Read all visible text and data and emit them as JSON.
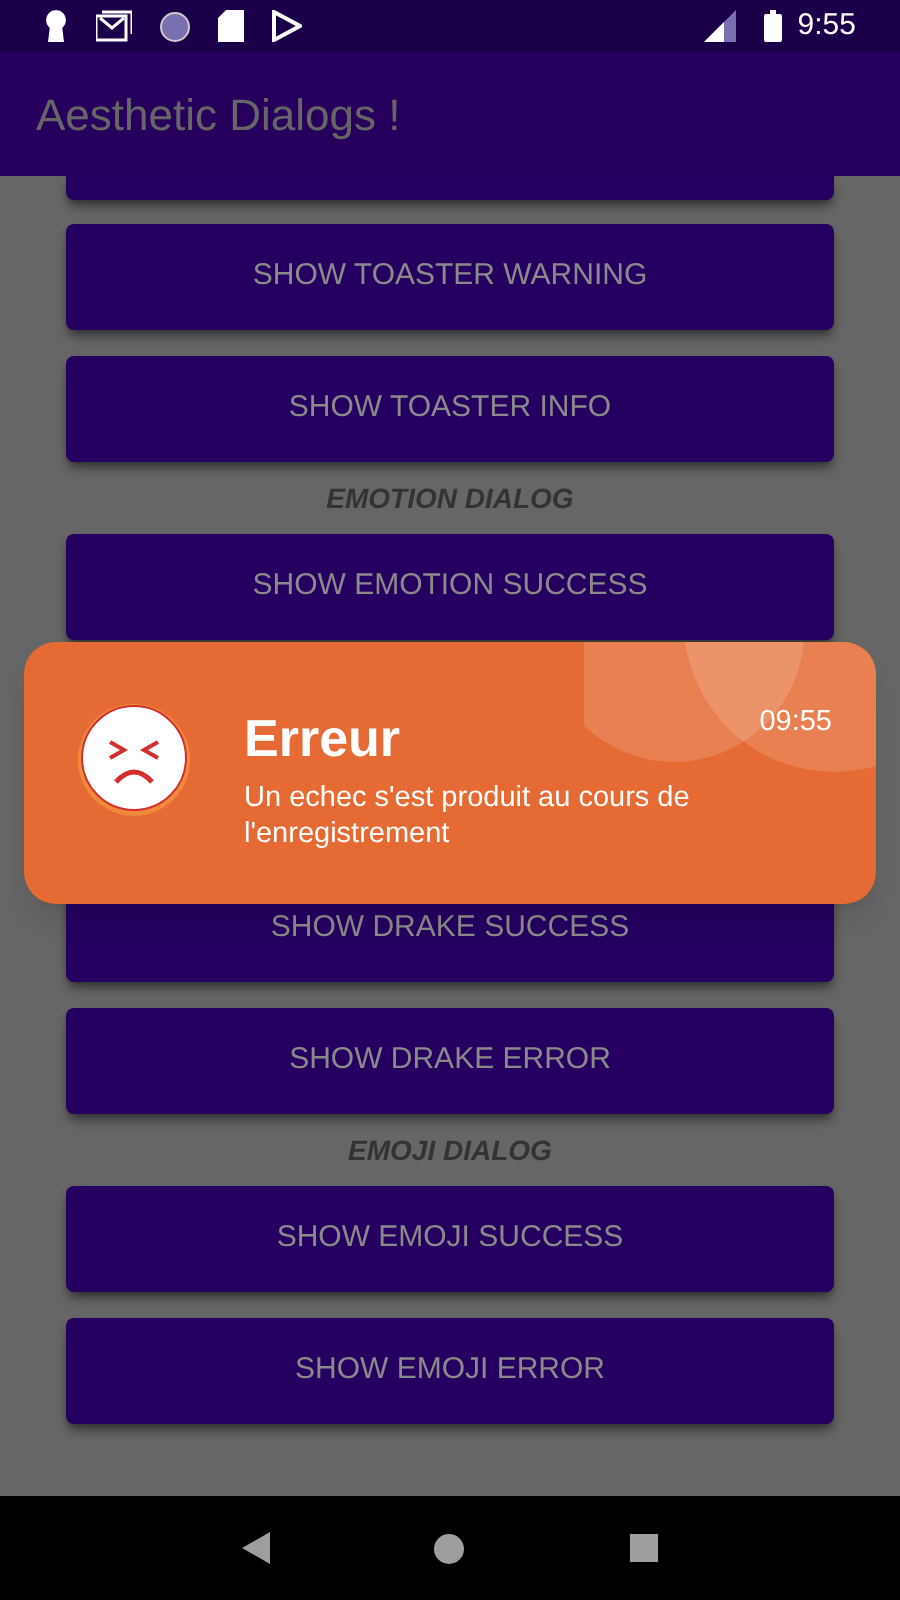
{
  "status_bar": {
    "time": "9:55"
  },
  "app_bar": {
    "title": "Aesthetic Dialogs !"
  },
  "sections": [
    {
      "kind": "buttons",
      "buttons": [
        "SHOW TOASTER WARNING",
        "SHOW TOASTER INFO"
      ]
    },
    {
      "kind": "header",
      "label": "EMOTION DIALOG"
    },
    {
      "kind": "buttons",
      "buttons": [
        "SHOW EMOTION SUCCESS"
      ]
    },
    {
      "kind": "hidden"
    },
    {
      "kind": "buttons",
      "buttons": [
        "SHOW DRAKE SUCCESS",
        "SHOW DRAKE ERROR"
      ]
    },
    {
      "kind": "header",
      "label": "EMOJI DIALOG"
    },
    {
      "kind": "buttons",
      "buttons": [
        "SHOW EMOJI SUCCESS",
        "SHOW EMOJI ERROR"
      ]
    }
  ],
  "toast": {
    "title": "Erreur",
    "message": "Un echec s'est produit au cours de l'enregistrement",
    "time": "09:55"
  }
}
